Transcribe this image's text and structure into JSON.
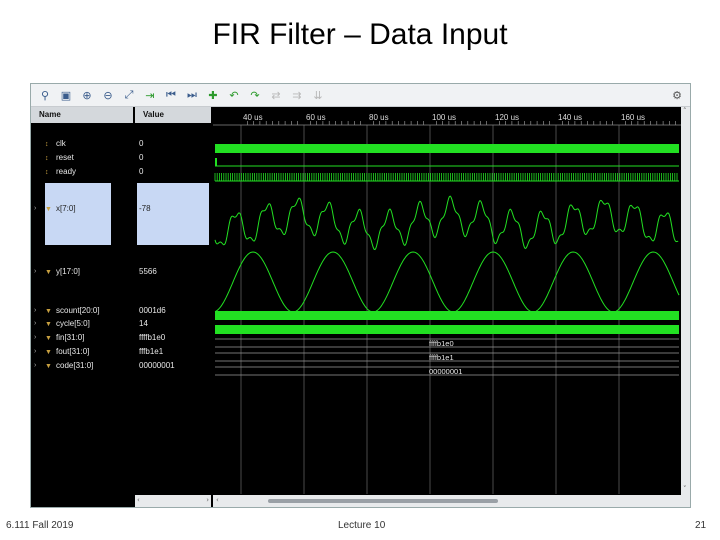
{
  "slide": {
    "title": "FIR Filter – Data Input",
    "footer_left": "6.111 Fall 2019",
    "footer_center": "Lecture 10",
    "footer_right": "21"
  },
  "toolbar": {
    "icons": [
      "search-icon",
      "save-icon",
      "zoom-in-icon",
      "zoom-out-icon",
      "zoom-fit-icon",
      "go-to-cursor-icon",
      "go-to-start-icon",
      "go-to-end-icon",
      "add-marker-icon",
      "prev-marker-icon",
      "next-marker-icon",
      "swap-cursors-icon",
      "snap-icon",
      "settings-icon"
    ]
  },
  "columns": {
    "name_header": "Name",
    "value_header": "Value"
  },
  "signals": [
    {
      "name": "clk",
      "value": "0",
      "type": "bit"
    },
    {
      "name": "reset",
      "value": "0",
      "type": "bit"
    },
    {
      "name": "ready",
      "value": "0",
      "type": "bit"
    },
    {
      "name": "x[7:0]",
      "value": "-78",
      "type": "bus"
    },
    {
      "name": "y[17:0]",
      "value": "5566",
      "type": "bus"
    },
    {
      "name": "scount[20:0]",
      "value": "0001d6",
      "type": "bus"
    },
    {
      "name": "cycle[5:0]",
      "value": "14",
      "type": "bus"
    },
    {
      "name": "fin[31:0]",
      "value": "ffffb1e0",
      "type": "bus"
    },
    {
      "name": "fout[31:0]",
      "value": "fffb1e1",
      "type": "bus"
    },
    {
      "name": "code[31:0]",
      "value": "00000001",
      "type": "bus"
    }
  ],
  "bus_values": {
    "fin": "ffffb1e0",
    "fout": "ffffb1e1",
    "code": "00000001"
  },
  "timeline": {
    "unit": "us",
    "ticks": [
      "40 us",
      "60 us",
      "80 us",
      "100 us",
      "120 us",
      "140 us",
      "160 us"
    ]
  },
  "colors": {
    "wave": "#22e022",
    "bus_line": "#9a9a9a",
    "grid": "#4a4a4a",
    "selection": "#c8d8f4"
  }
}
